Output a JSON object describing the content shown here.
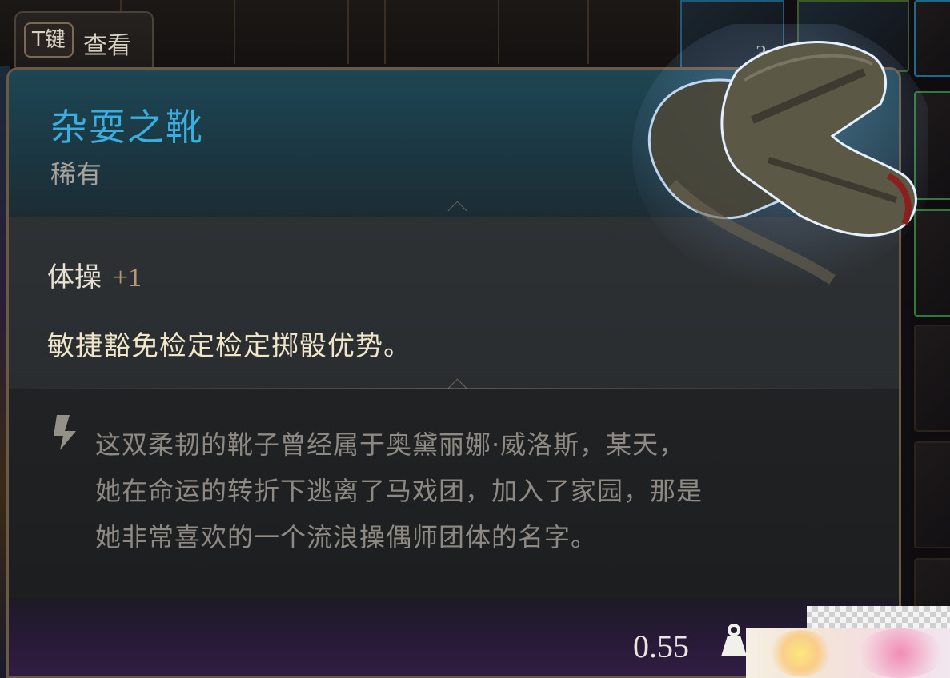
{
  "hint": {
    "key": "T键",
    "label": "查看"
  },
  "background": {
    "stack_quantity": "3"
  },
  "item": {
    "name": "杂耍之靴",
    "rarity": "稀有",
    "rarity_color": "#3aaede",
    "icon": "boots-icon",
    "stat": {
      "name": "体操",
      "value": "+1"
    },
    "effect": "敏捷豁免检定检定掷骰优势。",
    "lore_icon": "quill-icon",
    "lore_lines": [
      "这双柔韧的靴子曾经属于奥黛丽娜·威洛斯，某天，",
      "她在命运的转折下逃离了马戏团，加入了家园，那是",
      "她非常喜欢的一个流浪操偶师团体的名字。"
    ],
    "weight": "0.55",
    "weight_icon": "weight-icon"
  }
}
